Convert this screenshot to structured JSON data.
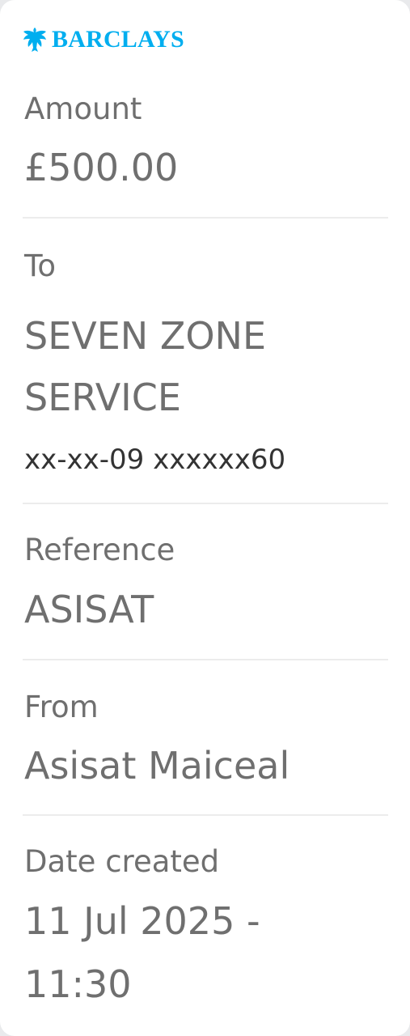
{
  "brand": {
    "name": "BARCLAYS",
    "color": "#00aeef",
    "icon": "eagle-icon"
  },
  "amount": {
    "label": "Amount",
    "value": "£500.00"
  },
  "to": {
    "label": "To",
    "name_line1": "SEVEN ZONE",
    "name_line2": "SERVICE",
    "account": "xx-xx-09 xxxxxx60"
  },
  "reference": {
    "label": "Reference",
    "value": "ASISAT"
  },
  "from": {
    "label": "From",
    "value": "Asisat Maiceal"
  },
  "date_created": {
    "label": "Date created",
    "value_line1": "11 Jul 2025 -",
    "value_line2": "11:30"
  }
}
